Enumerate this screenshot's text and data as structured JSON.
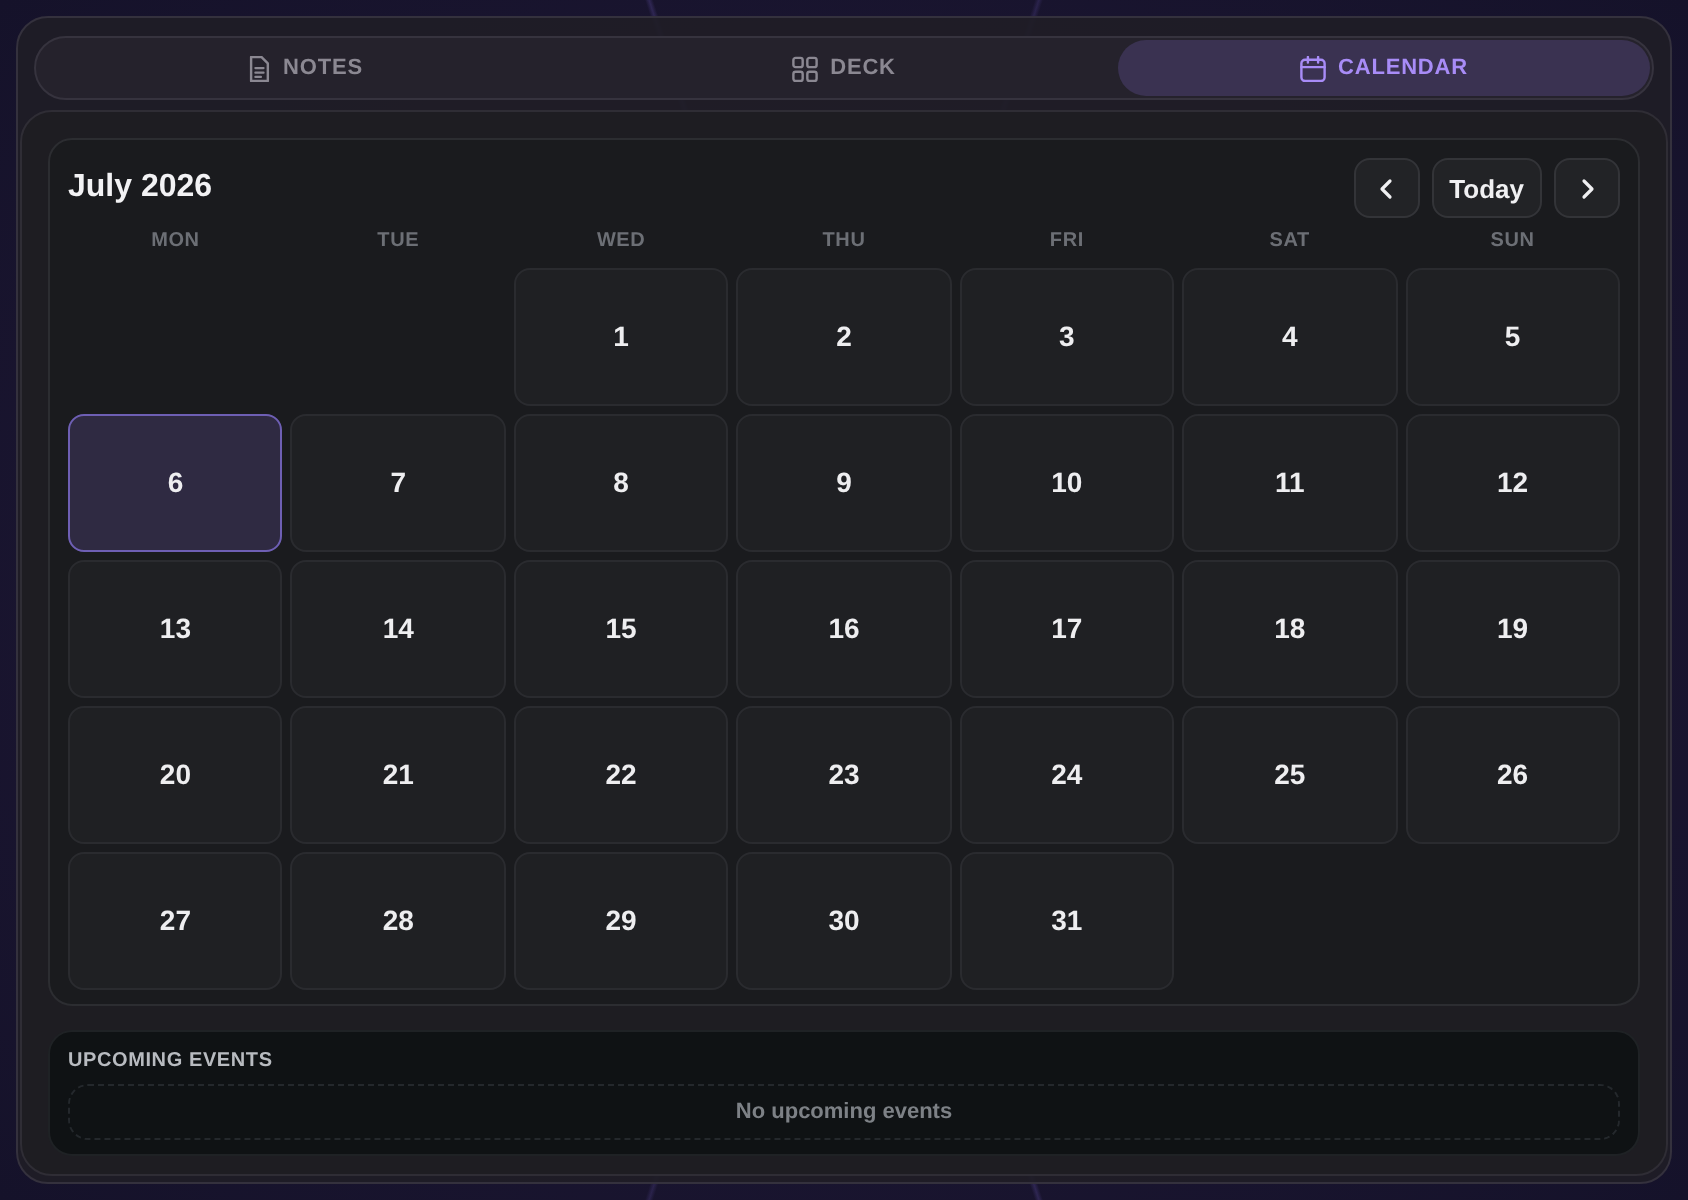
{
  "tabs": [
    {
      "label": "NOTES",
      "selected": false
    },
    {
      "label": "DECK",
      "selected": false
    },
    {
      "label": "CALENDAR",
      "selected": true
    }
  ],
  "calendar": {
    "title": "July 2026",
    "today_button": "Today",
    "weekdays": [
      "MON",
      "TUE",
      "WED",
      "THU",
      "FRI",
      "SAT",
      "SUN"
    ],
    "weeks": [
      [
        {
          "label": "1",
          "selected": false
        },
        {
          "label": "2",
          "selected": false
        },
        {
          "label": "3",
          "selected": false
        },
        {
          "label": "4",
          "selected": false
        },
        {
          "label": "5",
          "selected": false
        }
      ],
      [
        {
          "label": "6",
          "selected": true
        },
        {
          "label": "7",
          "selected": false
        },
        {
          "label": "8",
          "selected": false
        },
        {
          "label": "9",
          "selected": false
        },
        {
          "label": "10",
          "selected": false
        },
        {
          "label": "11",
          "selected": false
        },
        {
          "label": "12",
          "selected": false
        }
      ],
      [
        {
          "label": "13",
          "selected": false
        },
        {
          "label": "14",
          "selected": false
        },
        {
          "label": "15",
          "selected": false
        },
        {
          "label": "16",
          "selected": false
        },
        {
          "label": "17",
          "selected": false
        },
        {
          "label": "18",
          "selected": false
        },
        {
          "label": "19",
          "selected": false
        }
      ],
      [
        {
          "label": "20",
          "selected": false
        },
        {
          "label": "21",
          "selected": false
        },
        {
          "label": "22",
          "selected": false
        },
        {
          "label": "23",
          "selected": false
        },
        {
          "label": "24",
          "selected": false
        },
        {
          "label": "25",
          "selected": false
        },
        {
          "label": "26",
          "selected": false
        }
      ],
      [
        {
          "label": "27",
          "selected": false
        },
        {
          "label": "28",
          "selected": false
        },
        {
          "label": "29",
          "selected": false
        },
        {
          "label": "30",
          "selected": false
        },
        {
          "label": "31",
          "selected": false
        }
      ]
    ]
  },
  "upcoming": {
    "title": "UPCOMING EVENTS",
    "empty_message": "No upcoming events"
  }
}
